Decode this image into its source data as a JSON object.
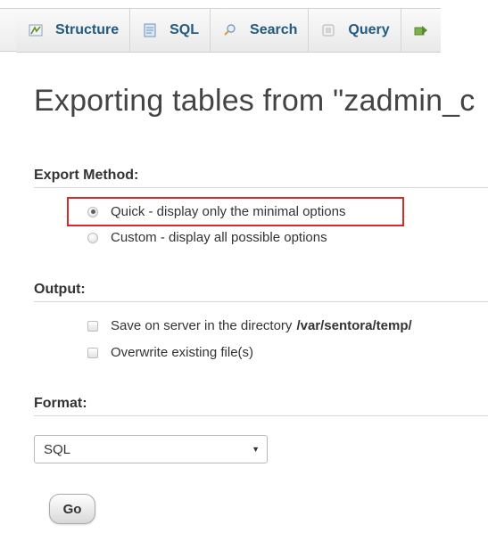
{
  "tabs": [
    {
      "label": "Structure",
      "icon": "structure-icon"
    },
    {
      "label": "SQL",
      "icon": "sql-icon"
    },
    {
      "label": "Search",
      "icon": "search-icon"
    },
    {
      "label": "Query",
      "icon": "query-icon"
    },
    {
      "label": "",
      "icon": "export-icon"
    }
  ],
  "heading": "Exporting tables from \"zadmin_c",
  "export_method": {
    "label": "Export Method:",
    "options": [
      {
        "label": "Quick - display only the minimal options",
        "selected": true
      },
      {
        "label": "Custom - display all possible options",
        "selected": false
      }
    ]
  },
  "output": {
    "label": "Output:",
    "save_on_server": {
      "label": "Save on server in the directory",
      "path": "/var/sentora/temp/",
      "checked": false
    },
    "overwrite": {
      "label": "Overwrite existing file(s)",
      "checked": false
    }
  },
  "format": {
    "label": "Format:",
    "selected": "SQL"
  },
  "go_label": "Go",
  "colors": {
    "highlight": "#d62b2b",
    "tab_text": "#235a81"
  }
}
